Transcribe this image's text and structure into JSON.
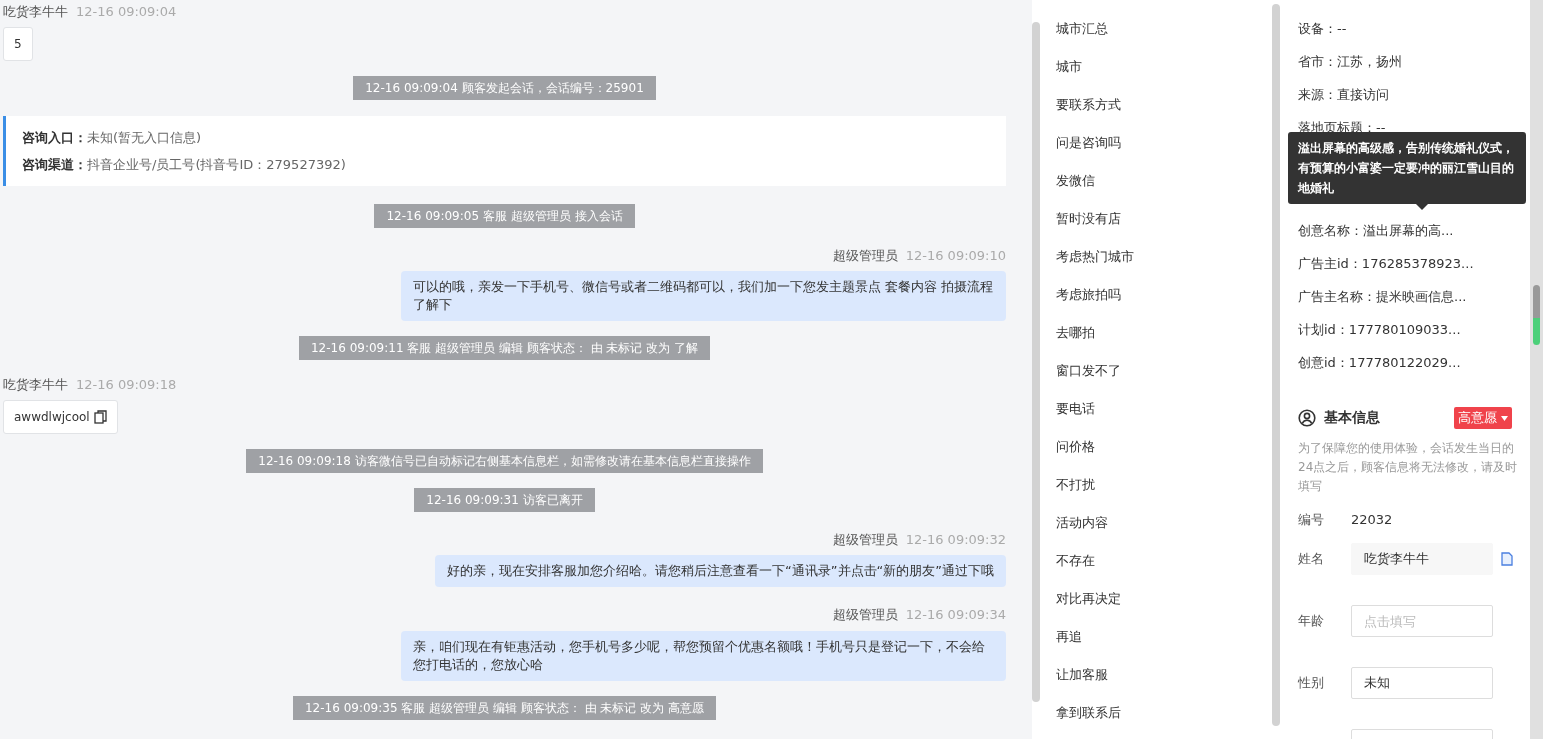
{
  "chat": [
    {
      "kind": "customer",
      "name": "吃货李牛牛",
      "time": "12-16 09:09:04",
      "text": "5",
      "copy": false
    },
    {
      "kind": "system",
      "text": "12-16 09:09:04 顾客发起会话，会话编号：25901"
    },
    {
      "kind": "info",
      "lines": [
        {
          "label": "咨询入口：",
          "value": "未知(暂无入口信息)"
        },
        {
          "label": "咨询渠道：",
          "value": "抖音企业号/员工号(抖音号ID：279527392)"
        }
      ]
    },
    {
      "kind": "system",
      "text": "12-16 09:09:05 客服 超级管理员 接入会话"
    },
    {
      "kind": "agent",
      "name": "超级管理员",
      "time": "12-16 09:09:10",
      "text": "可以的哦，亲发一下手机号、微信号或者二维码都可以，我们加一下您发主题景点 套餐内容 拍摄流程了解下"
    },
    {
      "kind": "system",
      "text": "12-16 09:09:11 客服 超级管理员 编辑 顾客状态： 由 未标记 改为 了解"
    },
    {
      "kind": "customer",
      "name": "吃货李牛牛",
      "time": "12-16 09:09:18",
      "text": "awwdlwjcool",
      "copy": true
    },
    {
      "kind": "system",
      "text": "12-16 09:09:18 访客微信号已自动标记右侧基本信息栏，如需修改请在基本信息栏直接操作"
    },
    {
      "kind": "system",
      "text": "12-16 09:09:31 访客已离开"
    },
    {
      "kind": "agent",
      "name": "超级管理员",
      "time": "12-16 09:09:32",
      "text": "好的亲，现在安排客服加您介绍哈。请您稍后注意查看一下“通讯录”并点击“新的朋友”通过下哦"
    },
    {
      "kind": "agent",
      "name": "超级管理员",
      "time": "12-16 09:09:34",
      "text": "亲，咱们现在有钜惠活动，您手机号多少呢，帮您预留个优惠名额哦！手机号只是登记一下，不会给您打电话的，您放心哈"
    },
    {
      "kind": "system",
      "text": "12-16 09:09:35 客服 超级管理员 编辑 顾客状态： 由 未标记 改为 高意愿"
    }
  ],
  "quick_replies": [
    "城市汇总",
    "城市",
    "要联系方式",
    "问是咨询吗",
    "发微信",
    "暂时没有店",
    "考虑热门城市",
    "考虑旅拍吗",
    "去哪拍",
    "窗口发不了",
    "要电话",
    "问价格",
    "不打扰",
    "活动内容",
    "不存在",
    "对比再决定",
    "再追",
    "让加客服",
    "拿到联系后"
  ],
  "visitor_info": {
    "rows_before": [
      "设备：--",
      "省市：江苏，扬州",
      "来源：直接访问",
      "落地页标题：--"
    ],
    "tooltip": "溢出屏幕的高级感，告别传统婚礼仪式，有预算的小富婆一定要冲的丽江雪山目的地婚礼",
    "rows_after": [
      "创意名称：溢出屏幕的高...",
      "广告主id：176285378923...",
      "广告主名称：提米映画信息...",
      "计划id：177780109033...",
      "创意id：177780122029..."
    ]
  },
  "basic_info": {
    "title": "基本信息",
    "tag": "高意愿",
    "note": "为了保障您的使用体验，会话发生当日的24点之后，顾客信息将无法修改，请及时填写",
    "fields": [
      {
        "kind": "text",
        "label": "编号",
        "value": "22032"
      },
      {
        "kind": "filled",
        "label": "姓名",
        "value": "吃货李牛牛",
        "copy": true
      },
      {
        "kind": "input",
        "label": "年龄",
        "placeholder": "点击填写"
      },
      {
        "kind": "input",
        "label": "性别",
        "value": "未知"
      },
      {
        "kind": "input"
      }
    ]
  }
}
